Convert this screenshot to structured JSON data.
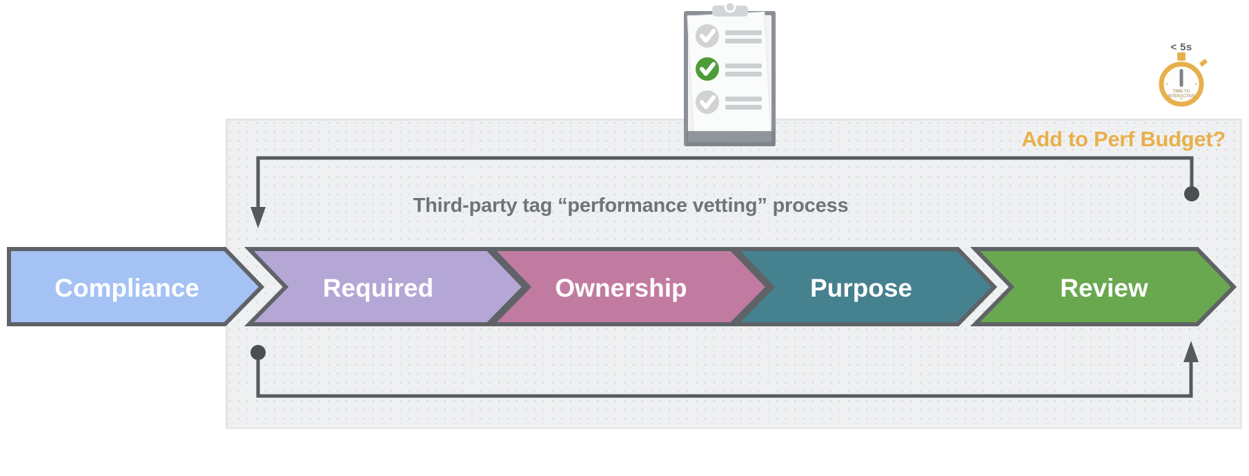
{
  "panel": {
    "heading": "Add to Perf Budget?",
    "process_title": "Third-party tag “performance vetting” process",
    "background_color": "#eff0f1",
    "border_color": "#e2e3e5"
  },
  "stopwatch": {
    "icon_name": "stopwatch-icon",
    "threshold_label": "< 5s",
    "dial_line1": "TIME-TO",
    "dial_line2": "INTERACTIVE",
    "color": "#e8b04b"
  },
  "clipboard": {
    "icon_name": "clipboard-checklist-icon",
    "checked_item_index": 1,
    "items": 3,
    "check_color": "#4f9b38",
    "unchecked_color": "#d0d2d4"
  },
  "flow": {
    "stroke_color": "#565a5e",
    "steps": [
      {
        "label": "Compliance",
        "fill": "#a4c2f4",
        "stroke": "#5f6368",
        "text_color": "#ffffff"
      },
      {
        "label": "Required",
        "fill": "#b4a7d6",
        "stroke": "#5f6368",
        "text_color": "#ffffff"
      },
      {
        "label": "Ownership",
        "fill": "#c27ba0",
        "stroke": "#5f6368",
        "text_color": "#ffffff"
      },
      {
        "label": "Purpose",
        "fill": "#45818e",
        "stroke": "#5f6368",
        "text_color": "#ffffff"
      },
      {
        "label": "Review",
        "fill": "#6aa84f",
        "stroke": "#5f6368",
        "text_color": "#ffffff"
      }
    ],
    "connectors": [
      {
        "name": "top-feedback-loop",
        "from": "review-step",
        "to": "required-step",
        "from_cap": "dot",
        "to_cap": "arrow",
        "position": "above"
      },
      {
        "name": "bottom-feedback-loop",
        "from": "compliance-step",
        "to": "review-step",
        "from_cap": "dot",
        "to_cap": "arrow",
        "position": "below"
      }
    ]
  }
}
